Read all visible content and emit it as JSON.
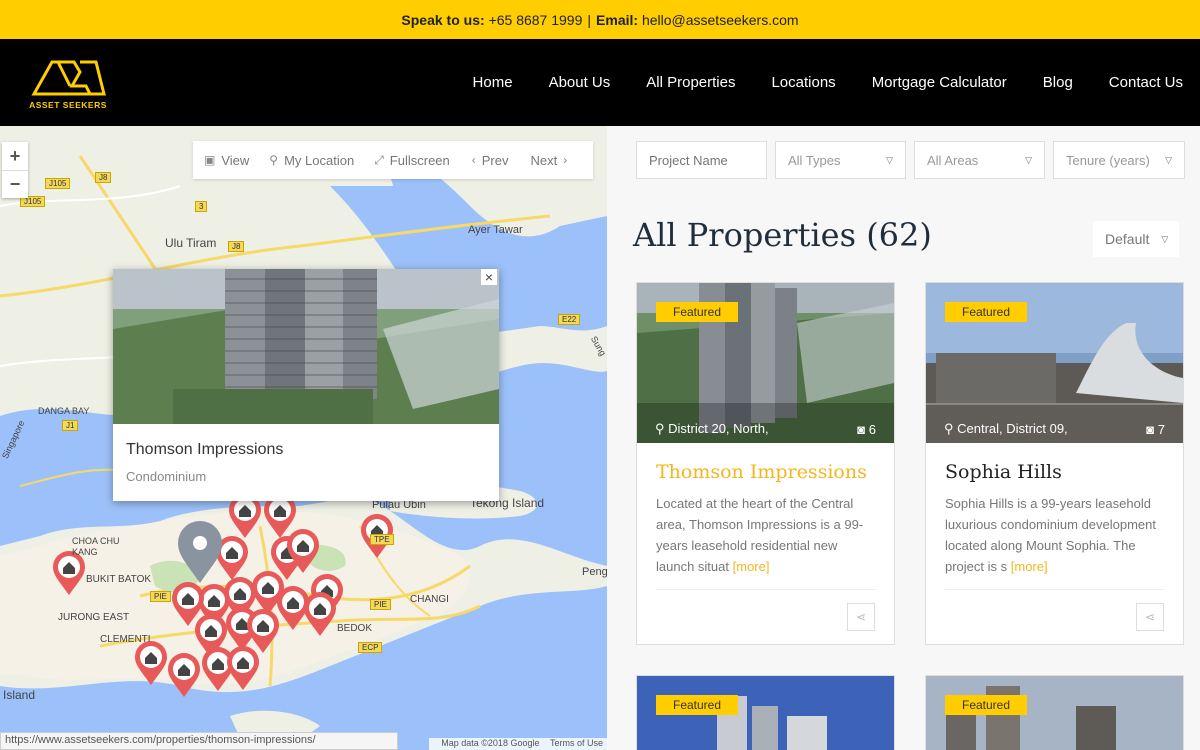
{
  "topbar": {
    "speak_label": "Speak to us:",
    "phone": "+65 8687 1999",
    "separator": "|",
    "email_label": "Email:",
    "email": "hello@assetseekers.com"
  },
  "brand": {
    "name": "ASSET SEEKERS",
    "accent": "#ffcd00"
  },
  "nav": {
    "items": [
      "Home",
      "About Us",
      "All Properties",
      "Locations",
      "Mortgage Calculator",
      "Blog",
      "Contact Us"
    ]
  },
  "map": {
    "zoom_in": "+",
    "zoom_out": "−",
    "tools": {
      "view": "View",
      "my_location": "My Location",
      "fullscreen": "Fullscreen",
      "prev": "Prev",
      "next": "Next"
    },
    "labels": {
      "ulu_tiram": "Ulu Tiram",
      "ayer_tawar": "Ayer Tawar",
      "danga_bay": "DANGA BAY",
      "choa_chu_kang": "CHOA CHU\nKANG",
      "bukit_batok": "BUKIT BATOK",
      "jurong_east": "JURONG EAST",
      "clementi": "CLEMENTI",
      "pulau_ubin": "Pulau Ubin",
      "tekong": "Tekong Island",
      "changi": "CHANGI",
      "bedok": "BEDOK",
      "island": "Island",
      "peng": "Peng",
      "singapore": "Singapore",
      "sungai": "Sung"
    },
    "roads": {
      "j105a": "J105",
      "j8a": "J8",
      "j105b": "J105",
      "r3": "3",
      "j8b": "J8",
      "e22": "E22",
      "j1": "J1",
      "tpe": "TPE",
      "pie": "PIE",
      "pie2": "PIE",
      "ecp": "ECP",
      "cte": "TPE"
    },
    "popup": {
      "title": "Thomson Impressions",
      "type": "Condominium",
      "close": "×"
    },
    "status_url": "https://www.assetseekers.com/properties/thomson-impressions/",
    "attribution": {
      "data": "Map data ©2018 Google",
      "terms": "Terms of Use"
    }
  },
  "filters": {
    "project_name_placeholder": "Project Name",
    "types": "All Types",
    "areas": "All Areas",
    "tenure": "Tenure (years)"
  },
  "listing": {
    "heading": "All Properties (62)",
    "sort": "Default"
  },
  "cards": [
    {
      "badge": "Featured",
      "location": "District 20, North,",
      "photos": "6",
      "title": "Thomson Impressions",
      "desc": "Located at the heart of the Central area, Thomson Impressions is a 99-years leasehold residential new launch situat",
      "more": "[more]"
    },
    {
      "badge": "Featured",
      "location": "Central, District 09,",
      "photos": "7",
      "title": "Sophia Hills",
      "desc": "Sophia Hills is a 99-years leasehold luxurious condominium development located along Mount Sophia. The project is s",
      "more": "[more]"
    },
    {
      "badge": "Featured"
    },
    {
      "badge": "Featured"
    }
  ]
}
